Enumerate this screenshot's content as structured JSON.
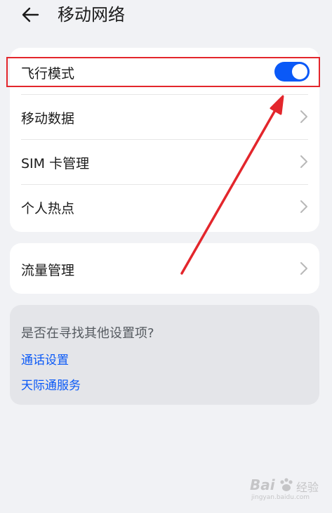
{
  "header": {
    "title": "移动网络",
    "back_icon": "arrow-left-icon"
  },
  "card1": {
    "items": [
      {
        "label": "飞行模式",
        "control": "toggle",
        "toggle_on": true
      },
      {
        "label": "移动数据",
        "control": "chevron"
      },
      {
        "label": "SIM 卡管理",
        "control": "chevron"
      },
      {
        "label": "个人热点",
        "control": "chevron"
      }
    ]
  },
  "card2": {
    "items": [
      {
        "label": "流量管理",
        "control": "chevron"
      }
    ]
  },
  "suggestions": {
    "title": "是否在寻找其他设置项?",
    "links": [
      "通话设置",
      "天际通服务"
    ]
  },
  "annotation": {
    "color": "#e3262c"
  },
  "watermark": {
    "brand": "Bai",
    "brand_suffix": "经验",
    "url": "jingyan.baidu.com"
  },
  "colors": {
    "accent": "#0a59f7",
    "background": "#f1f2f5",
    "card": "#ffffff",
    "suggest_card": "#e4e5e9"
  }
}
